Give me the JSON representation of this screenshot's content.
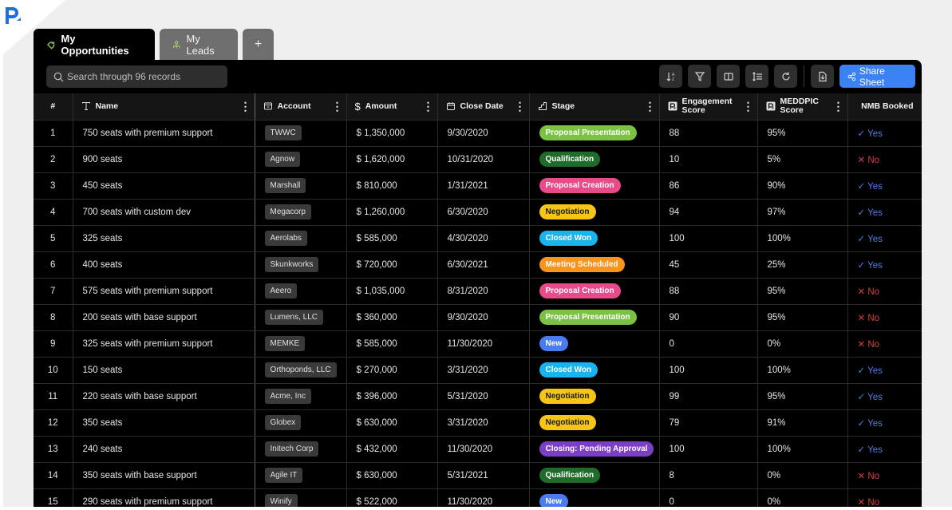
{
  "tabs": [
    {
      "label": "My Opportunities",
      "icon": "opportunity-icon",
      "active": true
    },
    {
      "label": "My Leads",
      "icon": "leads-icon",
      "active": false
    },
    {
      "label": "+",
      "icon": "plus-icon",
      "active": false
    }
  ],
  "toolbar": {
    "search_placeholder": "Search through 96 records",
    "buttons": [
      "sort-icon",
      "filter-icon",
      "columns-icon",
      "row-height-icon",
      "refresh-icon",
      "export-icon"
    ],
    "share_label": "Share Sheet"
  },
  "colors": {
    "accent": "#3b82f6",
    "yes": "#4f7de8",
    "no": "#d64040"
  },
  "columns": [
    {
      "label": "#",
      "icon": null
    },
    {
      "label": "Name",
      "icon": "text-type-icon"
    },
    {
      "label": "Account",
      "icon": "account-icon"
    },
    {
      "label": "Amount",
      "icon": "dollar-icon"
    },
    {
      "label": "Close Date",
      "icon": "calendar-icon"
    },
    {
      "label": "Stage",
      "icon": "stage-icon"
    },
    {
      "label": "Engagement Score",
      "icon": "p-logo-icon"
    },
    {
      "label": "MEDDPIC Score",
      "icon": "p-logo-icon"
    },
    {
      "label": "NMB Booked",
      "icon": "cube-icon"
    }
  ],
  "stages": {
    "Proposal Presentation": {
      "bg": "#7cc242",
      "fg": "#ffffff"
    },
    "Qualification": {
      "bg": "#1e6b2a",
      "fg": "#ffffff"
    },
    "Proposal Creation": {
      "bg": "#e84a8a",
      "fg": "#ffffff"
    },
    "Negotiation": {
      "bg": "#f5c518",
      "fg": "#1a1a1a"
    },
    "Closed Won": {
      "bg": "#18b4f0",
      "fg": "#ffffff"
    },
    "Meeting Scheduled": {
      "bg": "#f7941d",
      "fg": "#ffffff"
    },
    "New": {
      "bg": "#4a7cf0",
      "fg": "#ffffff"
    },
    "Closing: Pending Approval": {
      "bg": "#7a3fc4",
      "fg": "#ffffff"
    }
  },
  "rows": [
    {
      "n": "1",
      "name": "750 seats with premium support",
      "account": "TWWC",
      "amount": "$ 1,350,000",
      "close": "9/30/2020",
      "stage": "Proposal Presentation",
      "eng": "88",
      "meddpic": "95%",
      "booked": "Yes"
    },
    {
      "n": "2",
      "name": "900 seats",
      "account": "Agnow",
      "amount": "$ 1,620,000",
      "close": "10/31/2020",
      "stage": "Qualification",
      "eng": "10",
      "meddpic": "5%",
      "booked": "No"
    },
    {
      "n": "3",
      "name": "450 seats",
      "account": "Marshall",
      "amount": "$ 810,000",
      "close": "1/31/2021",
      "stage": "Proposal Creation",
      "eng": "86",
      "meddpic": "90%",
      "booked": "Yes"
    },
    {
      "n": "4",
      "name": "700 seats with custom dev",
      "account": "Megacorp",
      "amount": "$ 1,260,000",
      "close": "6/30/2020",
      "stage": "Negotiation",
      "eng": "94",
      "meddpic": "97%",
      "booked": "Yes"
    },
    {
      "n": "5",
      "name": "325 seats",
      "account": "Aerolabs",
      "amount": "$ 585,000",
      "close": "4/30/2020",
      "stage": "Closed Won",
      "eng": "100",
      "meddpic": "100%",
      "booked": "Yes"
    },
    {
      "n": "6",
      "name": "400 seats",
      "account": "Skunkworks",
      "amount": "$ 720,000",
      "close": "6/30/2021",
      "stage": "Meeting Scheduled",
      "eng": "45",
      "meddpic": "25%",
      "booked": "Yes"
    },
    {
      "n": "7",
      "name": "575 seats with premium support",
      "account": "Aeero",
      "amount": "$ 1,035,000",
      "close": "8/31/2020",
      "stage": "Proposal Creation",
      "eng": "88",
      "meddpic": "95%",
      "booked": "No"
    },
    {
      "n": "8",
      "name": "200 seats with base support",
      "account": "Lumens, LLC",
      "amount": "$ 360,000",
      "close": "9/30/2020",
      "stage": "Proposal Presentation",
      "eng": "90",
      "meddpic": "95%",
      "booked": "No"
    },
    {
      "n": "9",
      "name": "325 seats with premium support",
      "account": "MEMKE",
      "amount": "$ 585,000",
      "close": "11/30/2020",
      "stage": "New",
      "eng": "0",
      "meddpic": "0%",
      "booked": "No"
    },
    {
      "n": "10",
      "name": "150 seats",
      "account": "Orthoponds, LLC",
      "amount": "$ 270,000",
      "close": "3/31/2020",
      "stage": "Closed Won",
      "eng": "100",
      "meddpic": "100%",
      "booked": "Yes"
    },
    {
      "n": "11",
      "name": "220 seats with base support",
      "account": "Acme, Inc",
      "amount": "$ 396,000",
      "close": "5/31/2020",
      "stage": "Negotiation",
      "eng": "99",
      "meddpic": "95%",
      "booked": "Yes"
    },
    {
      "n": "12",
      "name": "350 seats",
      "account": "Globex",
      "amount": "$ 630,000",
      "close": "3/31/2020",
      "stage": "Negotiation",
      "eng": "79",
      "meddpic": "91%",
      "booked": "Yes"
    },
    {
      "n": "13",
      "name": "240 seats",
      "account": "Initech Corp",
      "amount": "$ 432,000",
      "close": "11/30/2020",
      "stage": "Closing: Pending Approval",
      "eng": "100",
      "meddpic": "100%",
      "booked": "Yes"
    },
    {
      "n": "14",
      "name": "350 seats with base support",
      "account": "Agile IT",
      "amount": "$ 630,000",
      "close": "5/31/2021",
      "stage": "Qualification",
      "eng": "8",
      "meddpic": "0%",
      "booked": "No"
    },
    {
      "n": "15",
      "name": "290 seats with premium support",
      "account": "Winify",
      "amount": "$ 522,000",
      "close": "11/30/2020",
      "stage": "New",
      "eng": "0",
      "meddpic": "0%",
      "booked": "No"
    }
  ]
}
